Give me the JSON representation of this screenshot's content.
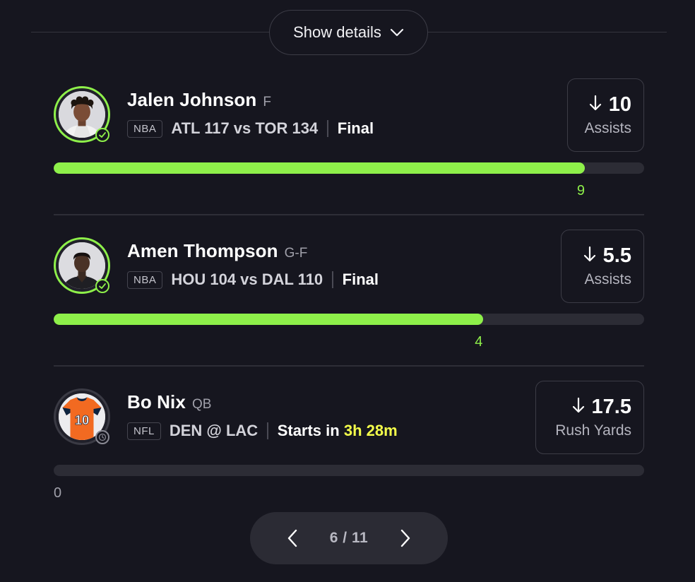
{
  "header": {
    "show_details_label": "Show details",
    "chevron_icon": "chevron-down-icon"
  },
  "picks": [
    {
      "name": "Jalen Johnson",
      "position": "F",
      "league": "NBA",
      "matchup": "ATL 117 vs TOR 134",
      "status": "Final",
      "line_direction": "down",
      "line": "10",
      "stat": "Assists",
      "progress_value": "9",
      "progress_fraction": 0.9,
      "avatar_status": "check-icon"
    },
    {
      "name": "Amen Thompson",
      "position": "G-F",
      "league": "NBA",
      "matchup": "HOU 104 vs DAL 110",
      "status": "Final",
      "line_direction": "down",
      "line": "5.5",
      "stat": "Assists",
      "progress_value": "4",
      "progress_fraction": 0.727,
      "avatar_status": "check-icon"
    },
    {
      "name": "Bo Nix",
      "position": "QB",
      "league": "NFL",
      "matchup": "DEN @ LAC",
      "status_prefix": "Starts in",
      "status_countdown": "3h 28m",
      "jersey_number": "10",
      "line_direction": "down",
      "line": "17.5",
      "stat": "Rush Yards",
      "progress_value": "0",
      "progress_fraction": 0,
      "avatar_status": "clock-icon"
    }
  ],
  "pager": {
    "text": "6 / 11",
    "prev_icon": "chevron-left-icon",
    "next_icon": "chevron-right-icon"
  },
  "colors": {
    "background": "#16161f",
    "accent_green": "#8ef04a",
    "countdown_yellow": "#f4ff4a",
    "track": "#2c2c35"
  }
}
